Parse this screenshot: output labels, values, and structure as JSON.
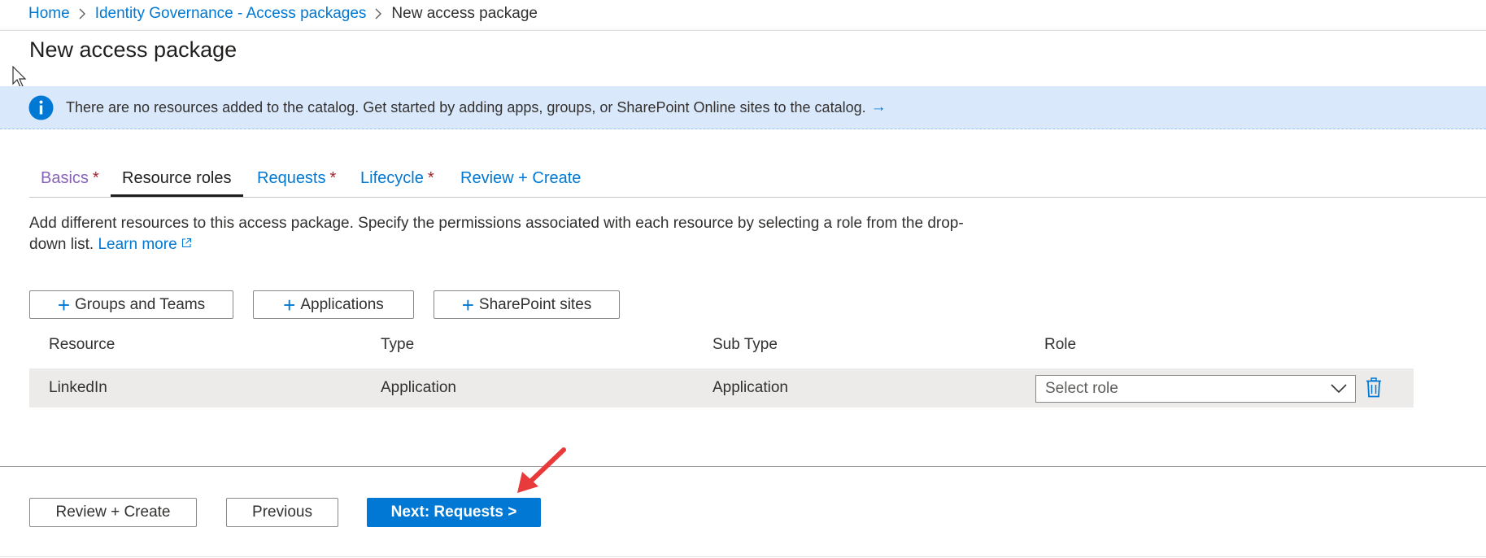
{
  "breadcrumb": {
    "items": [
      "Home",
      "Identity Governance - Access packages"
    ],
    "current": "New access package"
  },
  "page": {
    "title": "New access package"
  },
  "info_bar": {
    "icon": "info-icon",
    "message": "There are no resources added to the catalog. Get started by adding apps, groups, or SharePoint Online sites to the catalog.",
    "arrow": "→"
  },
  "tabs": [
    {
      "label": "Basics",
      "required": "*"
    },
    {
      "label": "Resource roles"
    },
    {
      "label": "Requests",
      "required": "*"
    },
    {
      "label": "Lifecycle",
      "required": "*"
    },
    {
      "label": "Review + Create"
    }
  ],
  "description": {
    "text": "Add different resources to this access package. Specify the permissions associated with each resource by selecting a role from the drop-down list.",
    "learn_more": "Learn more"
  },
  "add_buttons": {
    "groups": "Groups and Teams",
    "applications": "Applications",
    "sharepoint": "SharePoint sites"
  },
  "table": {
    "headers": [
      "Resource",
      "Type",
      "Sub Type",
      "Role"
    ],
    "rows": [
      {
        "resource": "LinkedIn",
        "type": "Application",
        "sub_type": "Application",
        "role_placeholder": "Select role"
      }
    ]
  },
  "footer": {
    "review_create": "Review + Create",
    "previous": "Previous",
    "next": "Next: Requests >"
  },
  "colors": {
    "accent": "#0078d4",
    "info_bg": "#d9e8fb",
    "visited_tab": "#8764b8",
    "required": "#a4262c",
    "annotation_arrow": "#e83a3a"
  }
}
